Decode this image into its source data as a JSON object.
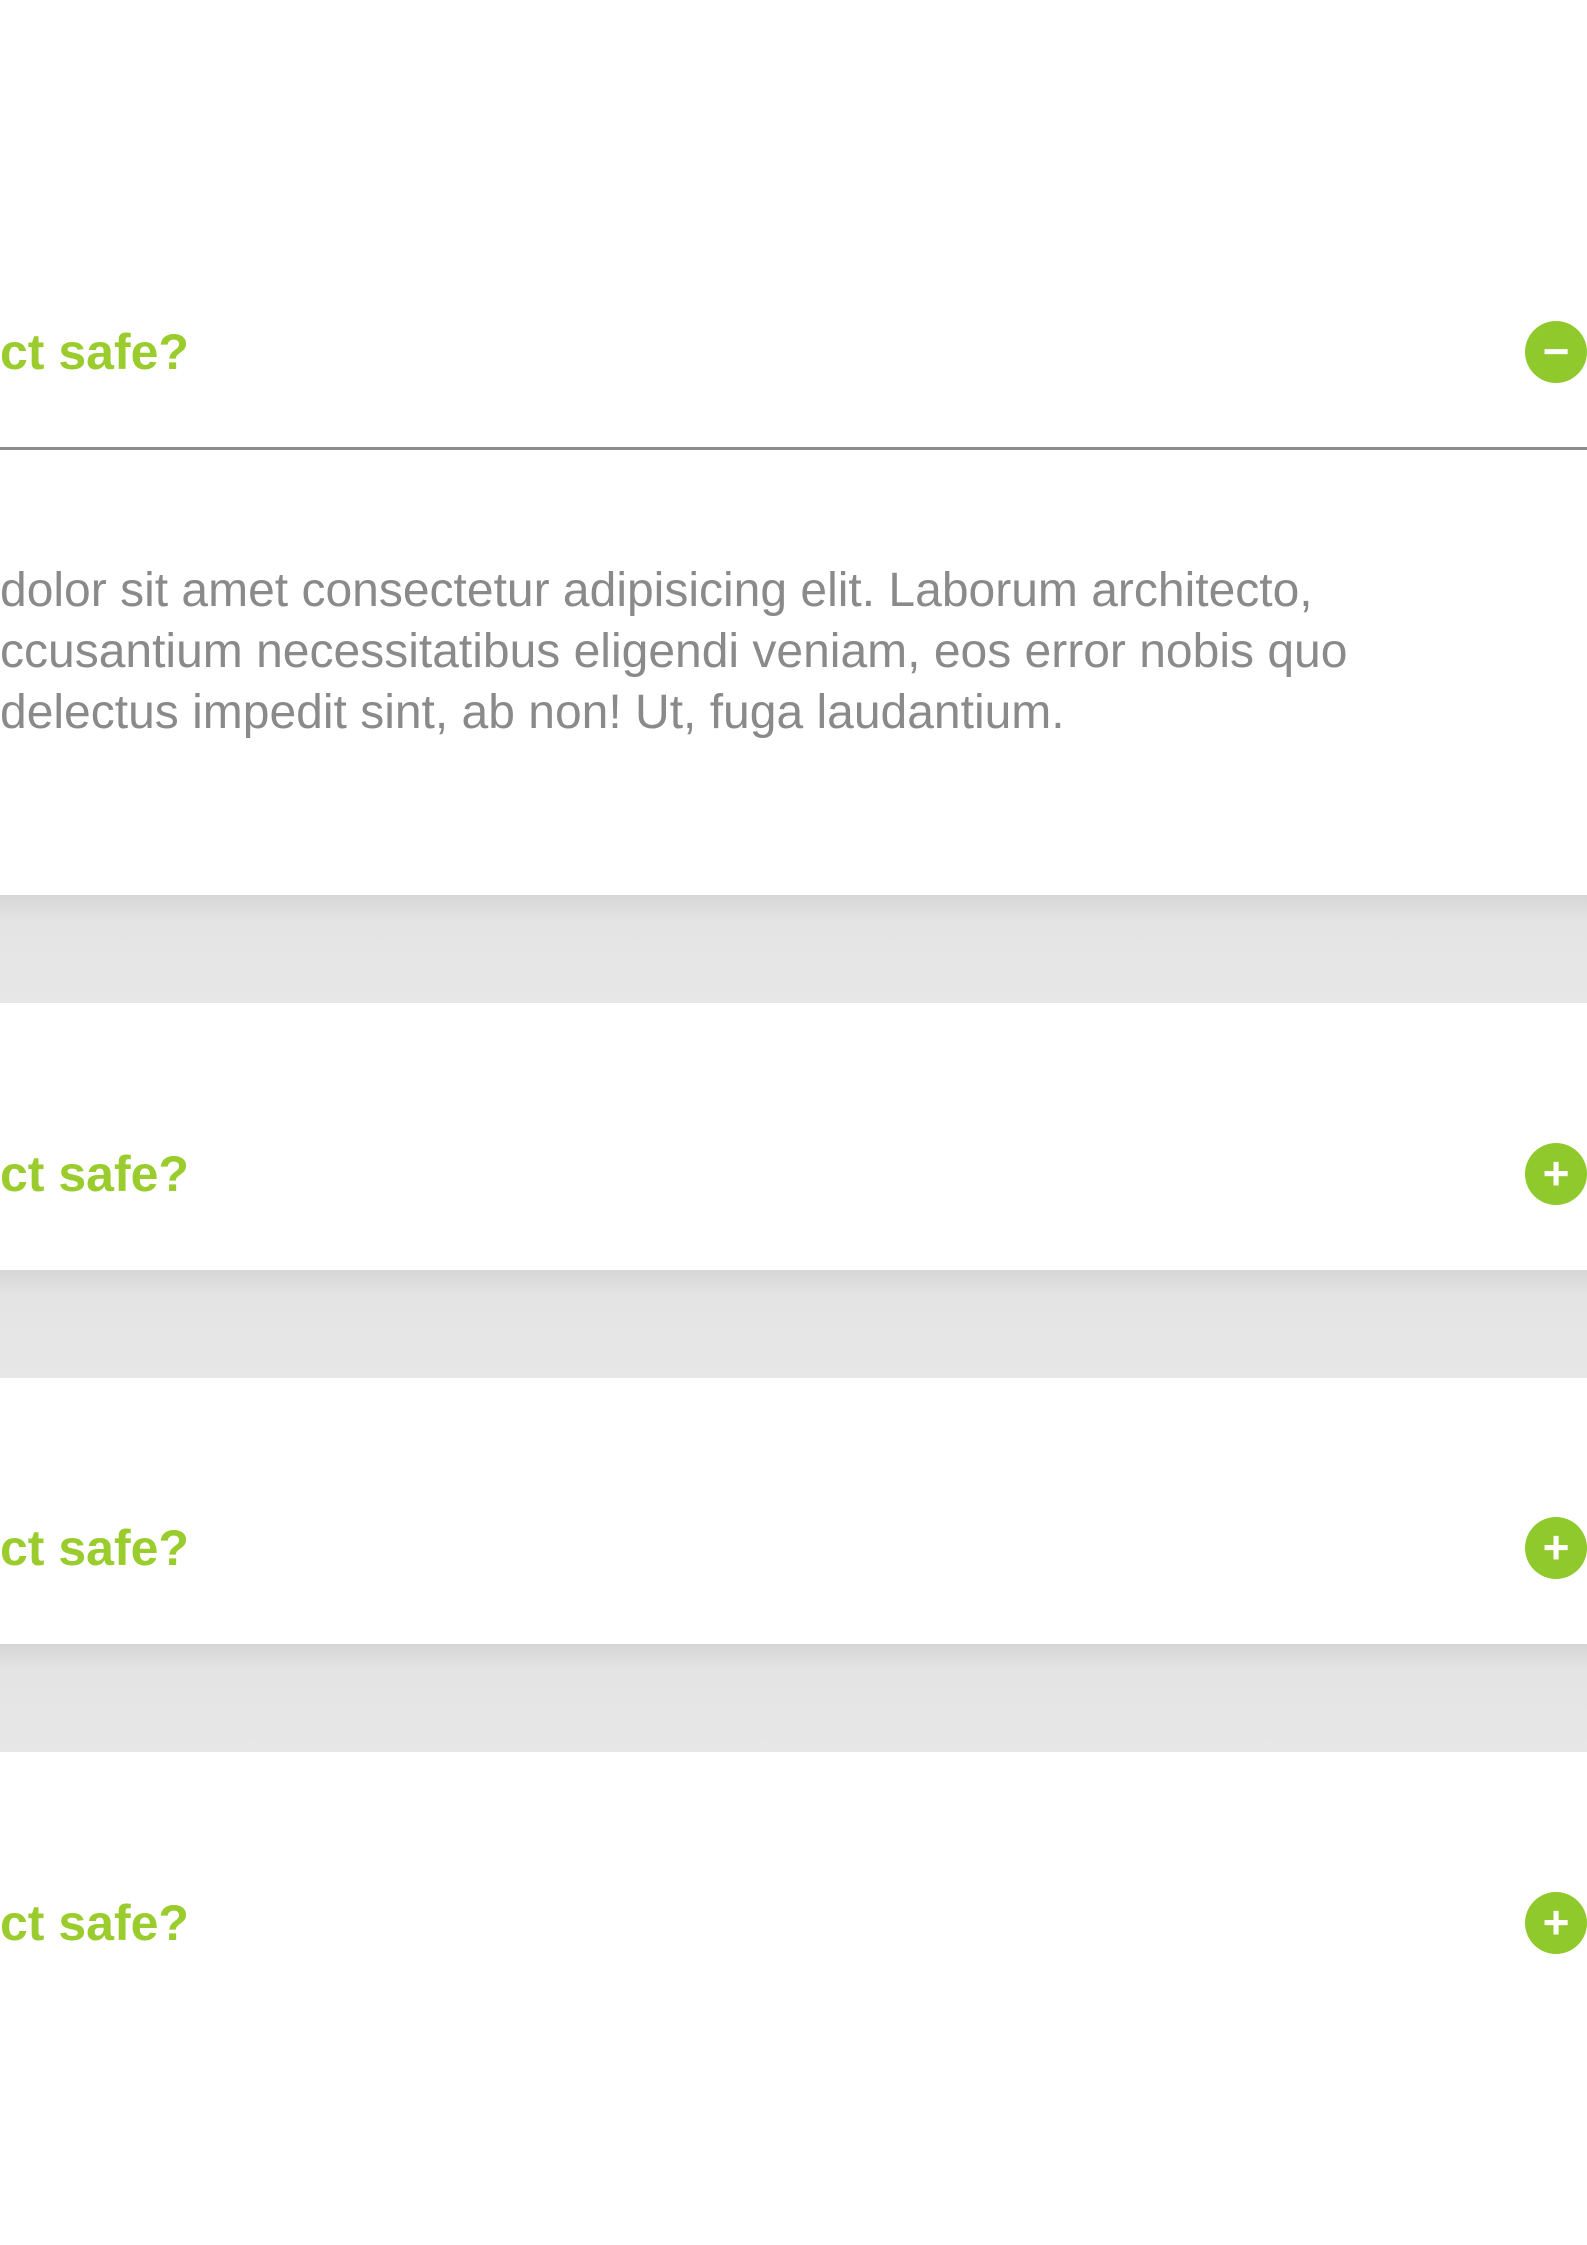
{
  "accent_color": "#9acc2e",
  "faq": {
    "items": [
      {
        "question": "ct safe?",
        "expanded": true,
        "toggle_icon": "minus-icon",
        "toggle_glyph": "−",
        "answer_lines": [
          "dolor sit amet consectetur adipisicing elit. Laborum architecto,",
          "ccusantium necessitatibus eligendi veniam, eos error nobis quo",
          "delectus impedit sint, ab non! Ut, fuga laudantium."
        ]
      },
      {
        "question": "ct safe?",
        "expanded": false,
        "toggle_icon": "plus-icon",
        "toggle_glyph": "+"
      },
      {
        "question": "ct safe?",
        "expanded": false,
        "toggle_icon": "plus-icon",
        "toggle_glyph": "+"
      },
      {
        "question": "ct safe?",
        "expanded": false,
        "toggle_icon": "plus-icon",
        "toggle_glyph": "+"
      }
    ]
  }
}
